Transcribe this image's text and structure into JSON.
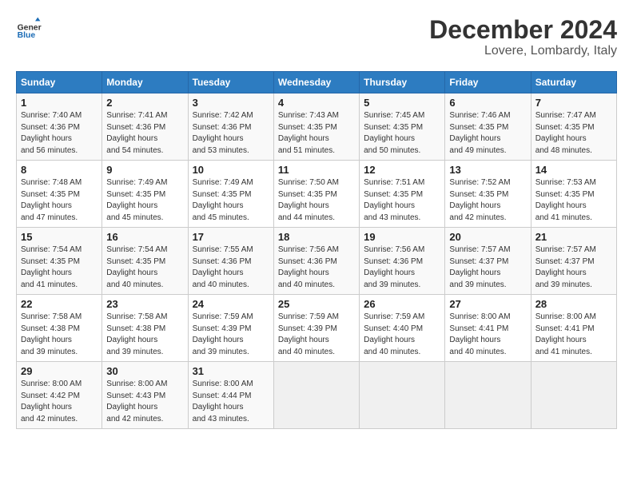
{
  "header": {
    "logo_line1": "General",
    "logo_line2": "Blue",
    "title": "December 2024",
    "subtitle": "Lovere, Lombardy, Italy"
  },
  "calendar": {
    "weekdays": [
      "Sunday",
      "Monday",
      "Tuesday",
      "Wednesday",
      "Thursday",
      "Friday",
      "Saturday"
    ],
    "weeks": [
      [
        {
          "day": "",
          "empty": true
        },
        {
          "day": "",
          "empty": true
        },
        {
          "day": "",
          "empty": true
        },
        {
          "day": "",
          "empty": true
        },
        {
          "day": "",
          "empty": true
        },
        {
          "day": "",
          "empty": true
        },
        {
          "day": "",
          "empty": true
        }
      ],
      [
        {
          "day": "1",
          "sunrise": "7:40 AM",
          "sunset": "4:36 PM",
          "daylight": "8 hours and 56 minutes."
        },
        {
          "day": "2",
          "sunrise": "7:41 AM",
          "sunset": "4:36 PM",
          "daylight": "8 hours and 54 minutes."
        },
        {
          "day": "3",
          "sunrise": "7:42 AM",
          "sunset": "4:36 PM",
          "daylight": "8 hours and 53 minutes."
        },
        {
          "day": "4",
          "sunrise": "7:43 AM",
          "sunset": "4:35 PM",
          "daylight": "8 hours and 51 minutes."
        },
        {
          "day": "5",
          "sunrise": "7:45 AM",
          "sunset": "4:35 PM",
          "daylight": "8 hours and 50 minutes."
        },
        {
          "day": "6",
          "sunrise": "7:46 AM",
          "sunset": "4:35 PM",
          "daylight": "8 hours and 49 minutes."
        },
        {
          "day": "7",
          "sunrise": "7:47 AM",
          "sunset": "4:35 PM",
          "daylight": "8 hours and 48 minutes."
        }
      ],
      [
        {
          "day": "8",
          "sunrise": "7:48 AM",
          "sunset": "4:35 PM",
          "daylight": "8 hours and 47 minutes."
        },
        {
          "day": "9",
          "sunrise": "7:49 AM",
          "sunset": "4:35 PM",
          "daylight": "8 hours and 45 minutes."
        },
        {
          "day": "10",
          "sunrise": "7:49 AM",
          "sunset": "4:35 PM",
          "daylight": "8 hours and 45 minutes."
        },
        {
          "day": "11",
          "sunrise": "7:50 AM",
          "sunset": "4:35 PM",
          "daylight": "8 hours and 44 minutes."
        },
        {
          "day": "12",
          "sunrise": "7:51 AM",
          "sunset": "4:35 PM",
          "daylight": "8 hours and 43 minutes."
        },
        {
          "day": "13",
          "sunrise": "7:52 AM",
          "sunset": "4:35 PM",
          "daylight": "8 hours and 42 minutes."
        },
        {
          "day": "14",
          "sunrise": "7:53 AM",
          "sunset": "4:35 PM",
          "daylight": "8 hours and 41 minutes."
        }
      ],
      [
        {
          "day": "15",
          "sunrise": "7:54 AM",
          "sunset": "4:35 PM",
          "daylight": "8 hours and 41 minutes."
        },
        {
          "day": "16",
          "sunrise": "7:54 AM",
          "sunset": "4:35 PM",
          "daylight": "8 hours and 40 minutes."
        },
        {
          "day": "17",
          "sunrise": "7:55 AM",
          "sunset": "4:36 PM",
          "daylight": "8 hours and 40 minutes."
        },
        {
          "day": "18",
          "sunrise": "7:56 AM",
          "sunset": "4:36 PM",
          "daylight": "8 hours and 40 minutes."
        },
        {
          "day": "19",
          "sunrise": "7:56 AM",
          "sunset": "4:36 PM",
          "daylight": "8 hours and 39 minutes."
        },
        {
          "day": "20",
          "sunrise": "7:57 AM",
          "sunset": "4:37 PM",
          "daylight": "8 hours and 39 minutes."
        },
        {
          "day": "21",
          "sunrise": "7:57 AM",
          "sunset": "4:37 PM",
          "daylight": "8 hours and 39 minutes."
        }
      ],
      [
        {
          "day": "22",
          "sunrise": "7:58 AM",
          "sunset": "4:38 PM",
          "daylight": "8 hours and 39 minutes."
        },
        {
          "day": "23",
          "sunrise": "7:58 AM",
          "sunset": "4:38 PM",
          "daylight": "8 hours and 39 minutes."
        },
        {
          "day": "24",
          "sunrise": "7:59 AM",
          "sunset": "4:39 PM",
          "daylight": "8 hours and 39 minutes."
        },
        {
          "day": "25",
          "sunrise": "7:59 AM",
          "sunset": "4:39 PM",
          "daylight": "8 hours and 40 minutes."
        },
        {
          "day": "26",
          "sunrise": "7:59 AM",
          "sunset": "4:40 PM",
          "daylight": "8 hours and 40 minutes."
        },
        {
          "day": "27",
          "sunrise": "8:00 AM",
          "sunset": "4:41 PM",
          "daylight": "8 hours and 40 minutes."
        },
        {
          "day": "28",
          "sunrise": "8:00 AM",
          "sunset": "4:41 PM",
          "daylight": "8 hours and 41 minutes."
        }
      ],
      [
        {
          "day": "29",
          "sunrise": "8:00 AM",
          "sunset": "4:42 PM",
          "daylight": "8 hours and 42 minutes."
        },
        {
          "day": "30",
          "sunrise": "8:00 AM",
          "sunset": "4:43 PM",
          "daylight": "8 hours and 42 minutes."
        },
        {
          "day": "31",
          "sunrise": "8:00 AM",
          "sunset": "4:44 PM",
          "daylight": "8 hours and 43 minutes."
        },
        {
          "day": "",
          "empty": true
        },
        {
          "day": "",
          "empty": true
        },
        {
          "day": "",
          "empty": true
        },
        {
          "day": "",
          "empty": true
        }
      ]
    ]
  }
}
